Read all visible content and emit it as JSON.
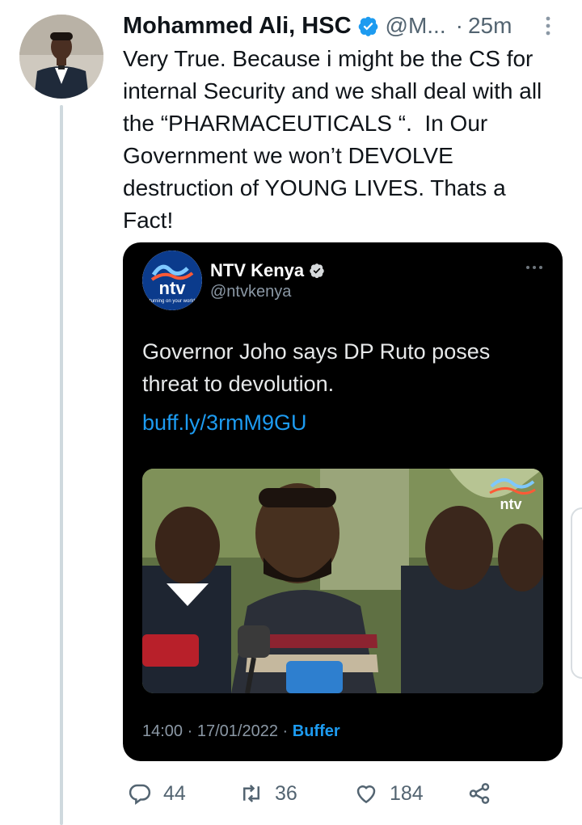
{
  "tweet": {
    "author_name": "Mohammed Ali, HSC",
    "handle": "@M...",
    "separator": "·",
    "time": "25m",
    "text": "Very True. Because i might be the CS for internal Security and we shall deal with all the “PHARMACEUTICALS “.  In Our Government we won’t DEVOLVE destruction of YOUNG LIVES. Thats a Fact!"
  },
  "quote": {
    "author_name": "NTV Kenya",
    "handle": "@ntvkenya",
    "text": "Governor Joho says DP Ruto poses threat to devolution.",
    "link": "buff.ly/3rmM9GU",
    "time": "14:00",
    "date": "17/01/2022",
    "source": "Buffer",
    "logo_text": "ntv",
    "logo_tagline": "turning on your world"
  },
  "actions": {
    "replies": "44",
    "retweets": "36",
    "likes": "184"
  },
  "colors": {
    "accent": "#1d9bf0",
    "text_primary": "#0f1419",
    "text_secondary": "#536471",
    "card_bg": "#000000"
  },
  "icons": {
    "verified": "verified-badge-icon",
    "more": "more-vertical-icon",
    "reply": "reply-icon",
    "retweet": "retweet-icon",
    "like": "heart-icon",
    "share": "share-icon"
  }
}
